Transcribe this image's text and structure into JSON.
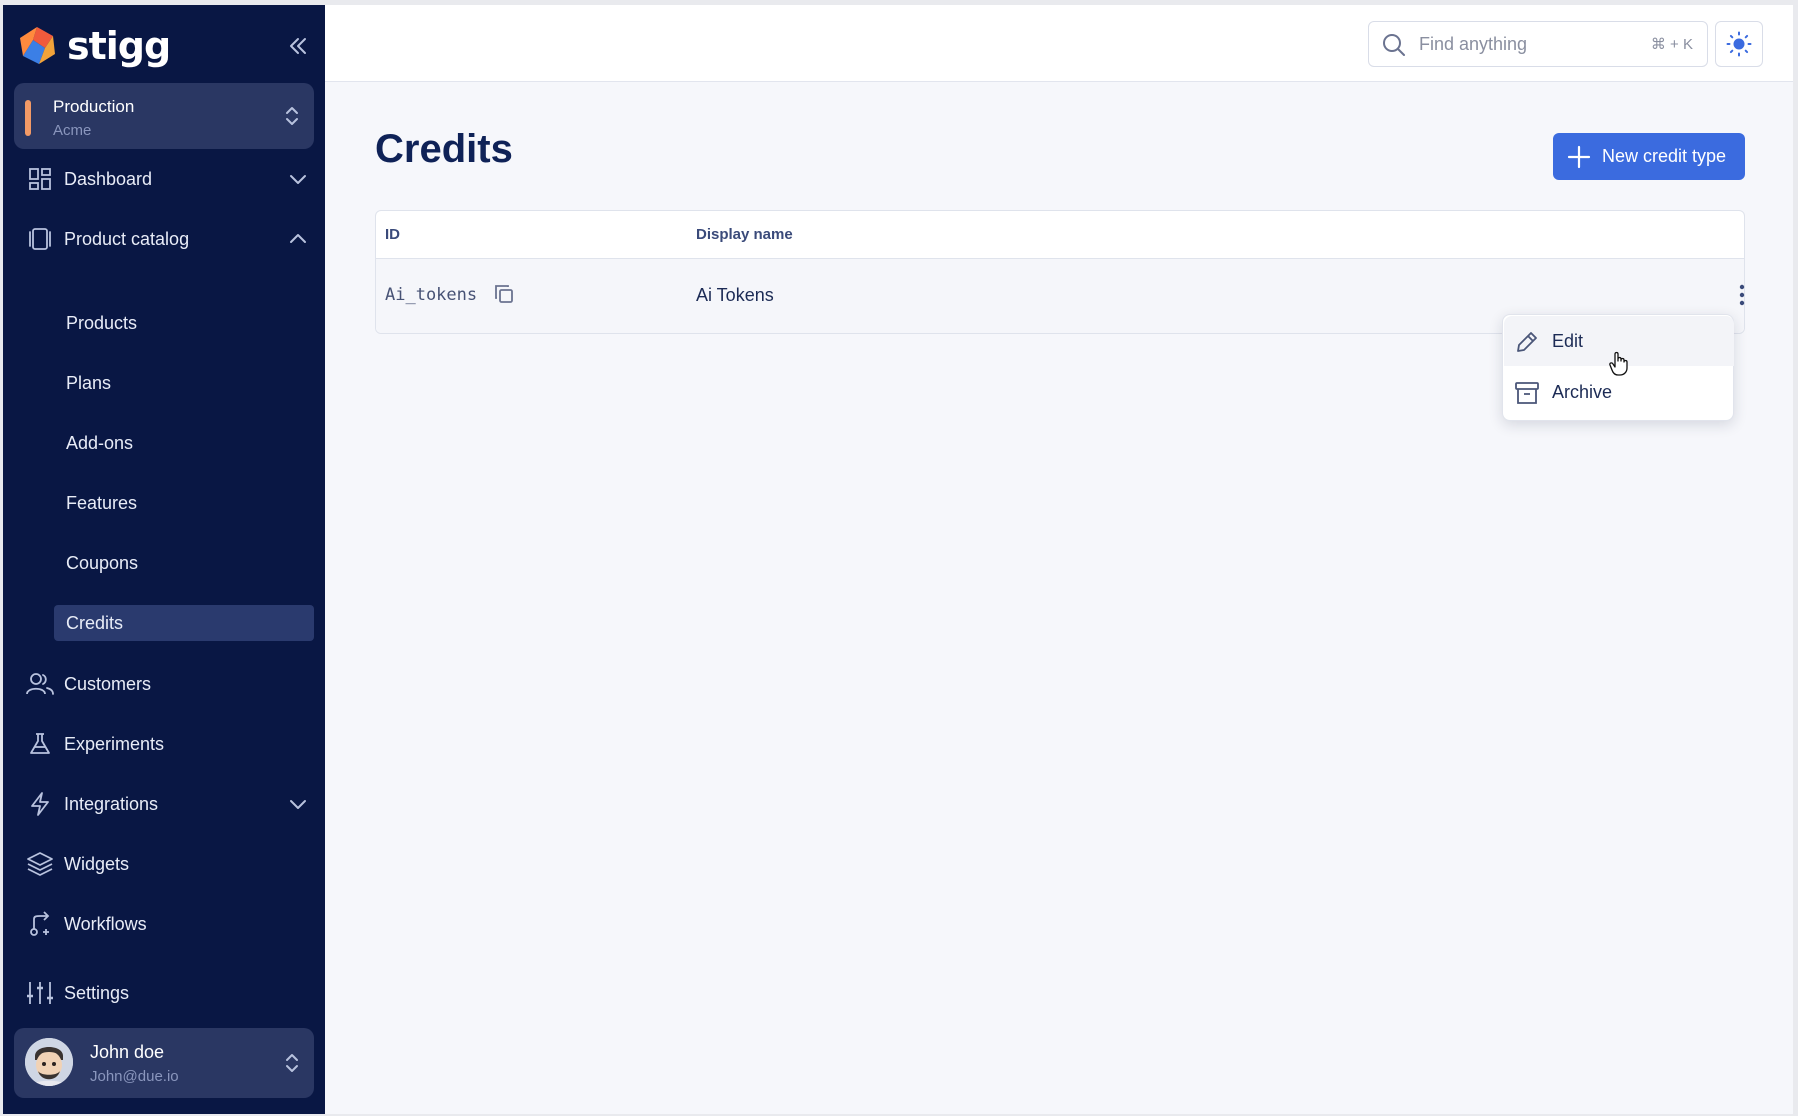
{
  "brand": {
    "name": "stigg"
  },
  "environment": {
    "name": "Production",
    "account": "Acme"
  },
  "nav": {
    "dashboard": "Dashboard",
    "product_catalog": "Product catalog",
    "sub_items": [
      "Products",
      "Plans",
      "Add-ons",
      "Features",
      "Coupons",
      "Credits"
    ],
    "customers": "Customers",
    "experiments": "Experiments",
    "integrations": "Integrations",
    "widgets": "Widgets",
    "workflows": "Workflows",
    "settings": "Settings"
  },
  "user": {
    "name": "John doe",
    "email": "John@due.io"
  },
  "search": {
    "placeholder": "Find anything",
    "shortcut": "⌘ + K"
  },
  "page": {
    "title": "Credits",
    "new_button": "New credit type"
  },
  "table": {
    "headers": [
      "ID",
      "Display name"
    ],
    "rows": [
      {
        "id": "Ai_tokens",
        "display_name": "Ai Tokens"
      }
    ]
  },
  "context_menu": {
    "items": [
      "Edit",
      "Archive"
    ]
  },
  "colors": {
    "sidebar": "#091744",
    "accent": "#3b6bdf",
    "env_marker": "#f39a66"
  }
}
